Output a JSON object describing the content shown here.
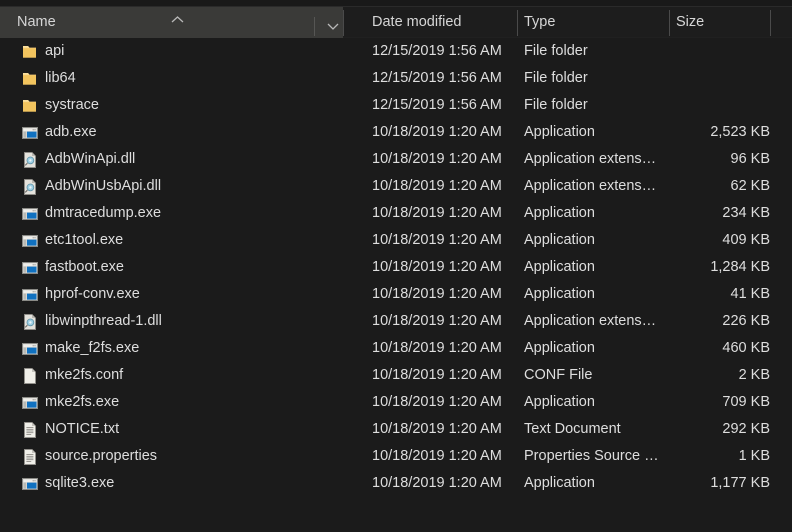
{
  "header": {
    "columns": [
      {
        "key": "name",
        "label": "Name",
        "sorted": true,
        "sort_direction": "ascending"
      },
      {
        "key": "date",
        "label": "Date modified",
        "sorted": false
      },
      {
        "key": "type",
        "label": "Type",
        "sorted": false
      },
      {
        "key": "size",
        "label": "Size",
        "sorted": false
      }
    ],
    "sort_caret_icon": "caret-up-icon",
    "name_dropdown_icon": "chevron-down-icon"
  },
  "colors": {
    "background": "#1b1b1b",
    "header_background": "#1d1d1d",
    "header_name_highlight": "#3a3a38",
    "text": "#dedede",
    "folder_icon": "#f7d080",
    "application_icon": "#1071c0",
    "separator": "#4a4a4a"
  },
  "files": [
    {
      "name": "api",
      "icon": "folder-icon",
      "date": "12/15/2019 1:56 AM",
      "type": "File folder",
      "size": ""
    },
    {
      "name": "lib64",
      "icon": "folder-icon",
      "date": "12/15/2019 1:56 AM",
      "type": "File folder",
      "size": ""
    },
    {
      "name": "systrace",
      "icon": "folder-icon",
      "date": "12/15/2019 1:56 AM",
      "type": "File folder",
      "size": ""
    },
    {
      "name": "adb.exe",
      "icon": "application-icon",
      "date": "10/18/2019 1:20 AM",
      "type": "Application",
      "size": "2,523 KB"
    },
    {
      "name": "AdbWinApi.dll",
      "icon": "dll-icon",
      "date": "10/18/2019 1:20 AM",
      "type": "Application extens…",
      "size": "96 KB"
    },
    {
      "name": "AdbWinUsbApi.dll",
      "icon": "dll-icon",
      "date": "10/18/2019 1:20 AM",
      "type": "Application extens…",
      "size": "62 KB"
    },
    {
      "name": "dmtracedump.exe",
      "icon": "application-icon",
      "date": "10/18/2019 1:20 AM",
      "type": "Application",
      "size": "234 KB"
    },
    {
      "name": "etc1tool.exe",
      "icon": "application-icon",
      "date": "10/18/2019 1:20 AM",
      "type": "Application",
      "size": "409 KB"
    },
    {
      "name": "fastboot.exe",
      "icon": "application-icon",
      "date": "10/18/2019 1:20 AM",
      "type": "Application",
      "size": "1,284 KB"
    },
    {
      "name": "hprof-conv.exe",
      "icon": "application-icon",
      "date": "10/18/2019 1:20 AM",
      "type": "Application",
      "size": "41 KB"
    },
    {
      "name": "libwinpthread-1.dll",
      "icon": "dll-icon",
      "date": "10/18/2019 1:20 AM",
      "type": "Application extens…",
      "size": "226 KB"
    },
    {
      "name": "make_f2fs.exe",
      "icon": "application-icon",
      "date": "10/18/2019 1:20 AM",
      "type": "Application",
      "size": "460 KB"
    },
    {
      "name": "mke2fs.conf",
      "icon": "blank-document-icon",
      "date": "10/18/2019 1:20 AM",
      "type": "CONF File",
      "size": "2 KB"
    },
    {
      "name": "mke2fs.exe",
      "icon": "application-icon",
      "date": "10/18/2019 1:20 AM",
      "type": "Application",
      "size": "709 KB"
    },
    {
      "name": "NOTICE.txt",
      "icon": "text-document-icon",
      "date": "10/18/2019 1:20 AM",
      "type": "Text Document",
      "size": "292 KB"
    },
    {
      "name": "source.properties",
      "icon": "text-document-icon",
      "date": "10/18/2019 1:20 AM",
      "type": "Properties Source …",
      "size": "1 KB"
    },
    {
      "name": "sqlite3.exe",
      "icon": "application-icon",
      "date": "10/18/2019 1:20 AM",
      "type": "Application",
      "size": "1,177 KB"
    }
  ]
}
